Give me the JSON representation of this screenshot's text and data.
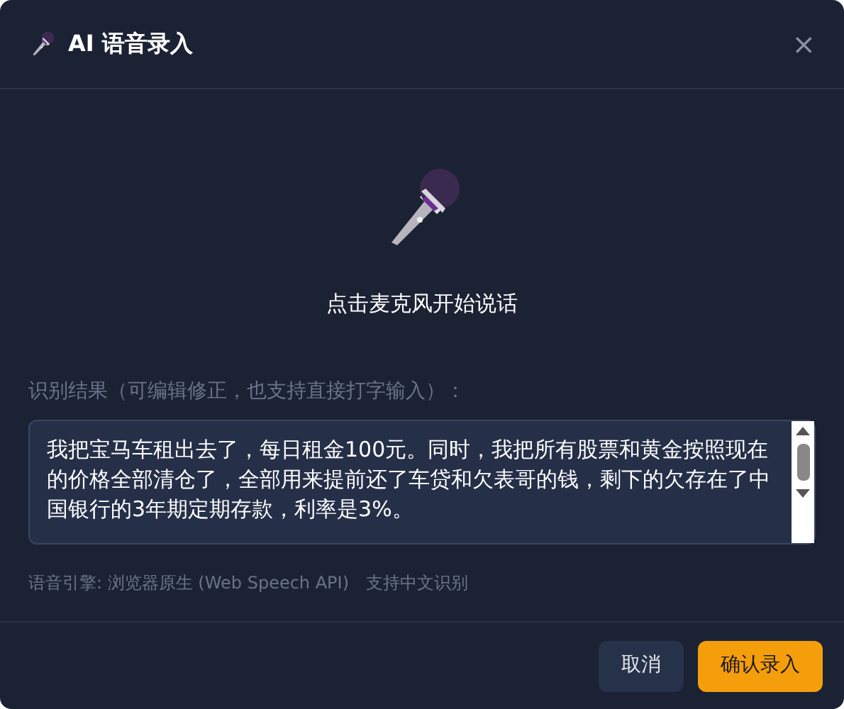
{
  "dialog": {
    "title": "AI 语音录入",
    "close": "×"
  },
  "prompt": "点击麦克风开始说话",
  "result": {
    "label": "识别结果（可编辑修正，也支持直接打字输入）：",
    "value": "我把宝马车租出去了，每日租金100元。同时，我把所有股票和黄金按照现在的价格全部清仓了，全部用来提前还了车贷和欠表哥的钱，剩下的欠存在了中国银行的3年期定期存款，利率是3%。"
  },
  "notes": [
    "语音引擎: 浏览器原生 (Web Speech API)",
    "支持中文识别"
  ],
  "buttons": [
    {
      "label": "取消",
      "kind": "secondary"
    },
    {
      "label": "确认录入",
      "kind": "primary"
    }
  ]
}
